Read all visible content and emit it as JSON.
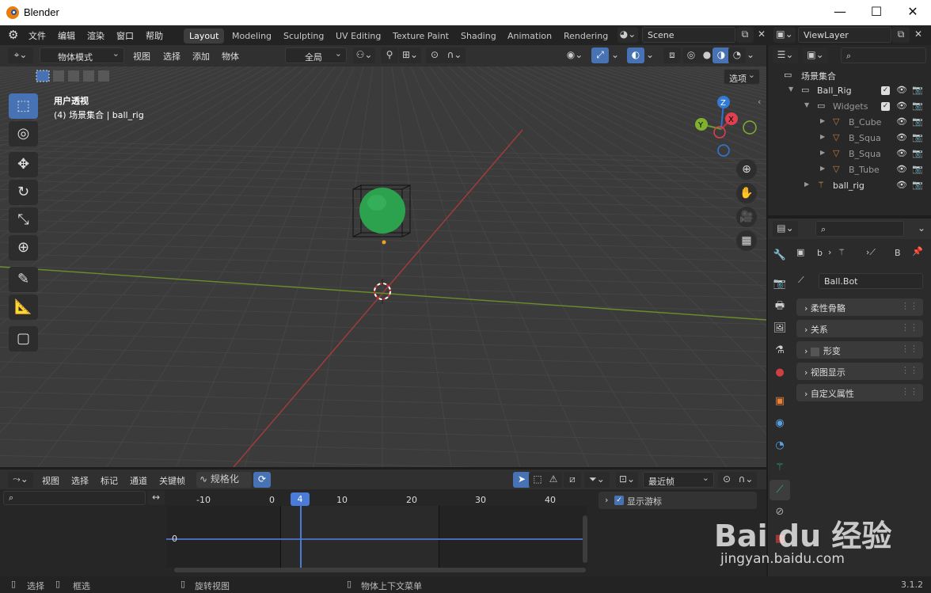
{
  "window": {
    "title": "Blender",
    "minimize": "—",
    "maximize": "☐",
    "close": "✕"
  },
  "menu": [
    "文件",
    "编辑",
    "渲染",
    "窗口",
    "帮助"
  ],
  "workspaces": [
    "Layout",
    "Modeling",
    "Sculpting",
    "UV Editing",
    "Texture Paint",
    "Shading",
    "Animation",
    "Rendering"
  ],
  "active_workspace": "Layout",
  "scene": {
    "name": "Scene"
  },
  "view_layer": {
    "name": "ViewLayer"
  },
  "viewport_header": {
    "mode": "物体模式",
    "menus": [
      "视图",
      "选择",
      "添加",
      "物体"
    ],
    "transform_orientation": "全局",
    "options": "选项"
  },
  "viewport": {
    "view_name": "用户透视",
    "collection_info": "(4) 场景集合 | ball_rig",
    "accent": "#4772b3",
    "sphere_color": "#2ca24f",
    "x_axis_color": "#a83a3a",
    "y_axis_color": "#6a8f2a"
  },
  "gizmo": {
    "z": "Z",
    "y": "Y",
    "x": "X"
  },
  "outliner": {
    "root": "场景集合",
    "rows": [
      {
        "label": "Ball_Rig",
        "indent": 1
      },
      {
        "label": "Widgets",
        "indent": 2
      },
      {
        "label": "B_Cube",
        "indent": 3
      },
      {
        "label": "B_Squa",
        "indent": 3
      },
      {
        "label": "B_Squa",
        "indent": 3
      },
      {
        "label": "B_Tube",
        "indent": 3
      },
      {
        "label": "ball_rig",
        "indent": 2
      }
    ]
  },
  "properties": {
    "breadcrumb_b": "b",
    "breadcrumb_end": "B",
    "bone_name": "Ball.Bot",
    "panels": [
      "柔性骨骼",
      "关系",
      "形变",
      "视图显示",
      "自定义属性"
    ]
  },
  "timeline": {
    "menus": [
      "视图",
      "选择",
      "标记",
      "通道",
      "关键帧"
    ],
    "normalize": "规格化",
    "snap": "最近帧",
    "ticks": [
      "-10",
      "0",
      "4",
      "10",
      "20",
      "30",
      "40"
    ],
    "current_frame": "4",
    "channel_value": "0",
    "show_cursor": "显示游标"
  },
  "status": {
    "select": "选择",
    "box_select": "框选",
    "rotate_view": "旋转视图",
    "context_menu": "物体上下文菜单",
    "version": "3.1.2"
  },
  "watermark": {
    "brand": "Bai du 经验",
    "url": "jingyan.baidu.com"
  }
}
